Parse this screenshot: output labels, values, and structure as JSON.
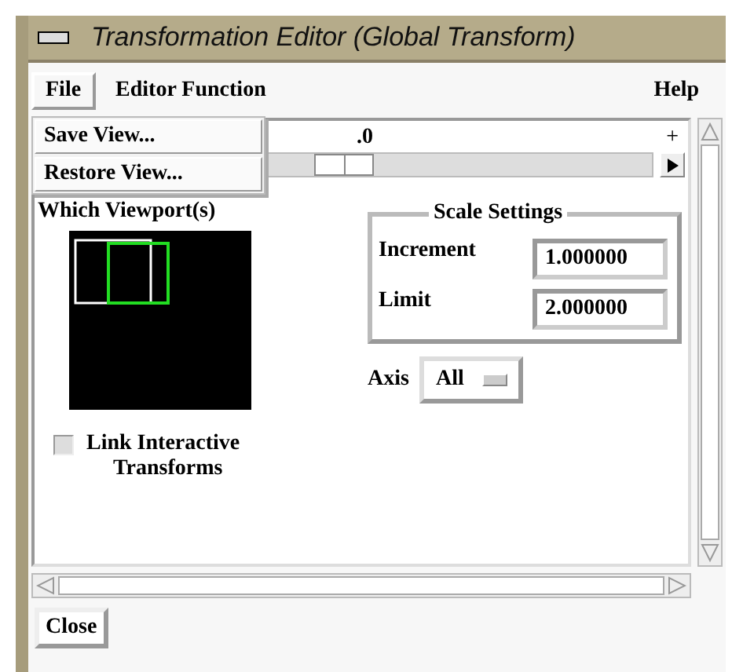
{
  "window": {
    "title": "Transformation Editor (Global Transform)"
  },
  "menu_bar": [
    {
      "label": "File",
      "selected": true
    },
    {
      "label": "Editor Function",
      "selected": false
    },
    {
      "label": "Help",
      "selected": false
    }
  ],
  "file_menu": {
    "items": [
      "Save View...",
      "Restore View..."
    ]
  },
  "slider": {
    "center_label": ".0",
    "max_label": "+",
    "level": 0.5
  },
  "viewports": {
    "label": "Which Viewport(s)",
    "items": [
      {
        "selected": false
      },
      {
        "selected": true
      }
    ]
  },
  "link_checkbox": {
    "label_line_1": "Link Interactive",
    "label_line_2": "Transforms",
    "checked": false
  },
  "scale_settings": {
    "title": "Scale Settings",
    "fields": [
      {
        "label": "Increment",
        "value": "1.000000"
      },
      {
        "label": "Limit",
        "value": "2.000000"
      }
    ]
  },
  "axis": {
    "label": "Axis",
    "value": "All"
  },
  "buttons": [
    "Close"
  ]
}
